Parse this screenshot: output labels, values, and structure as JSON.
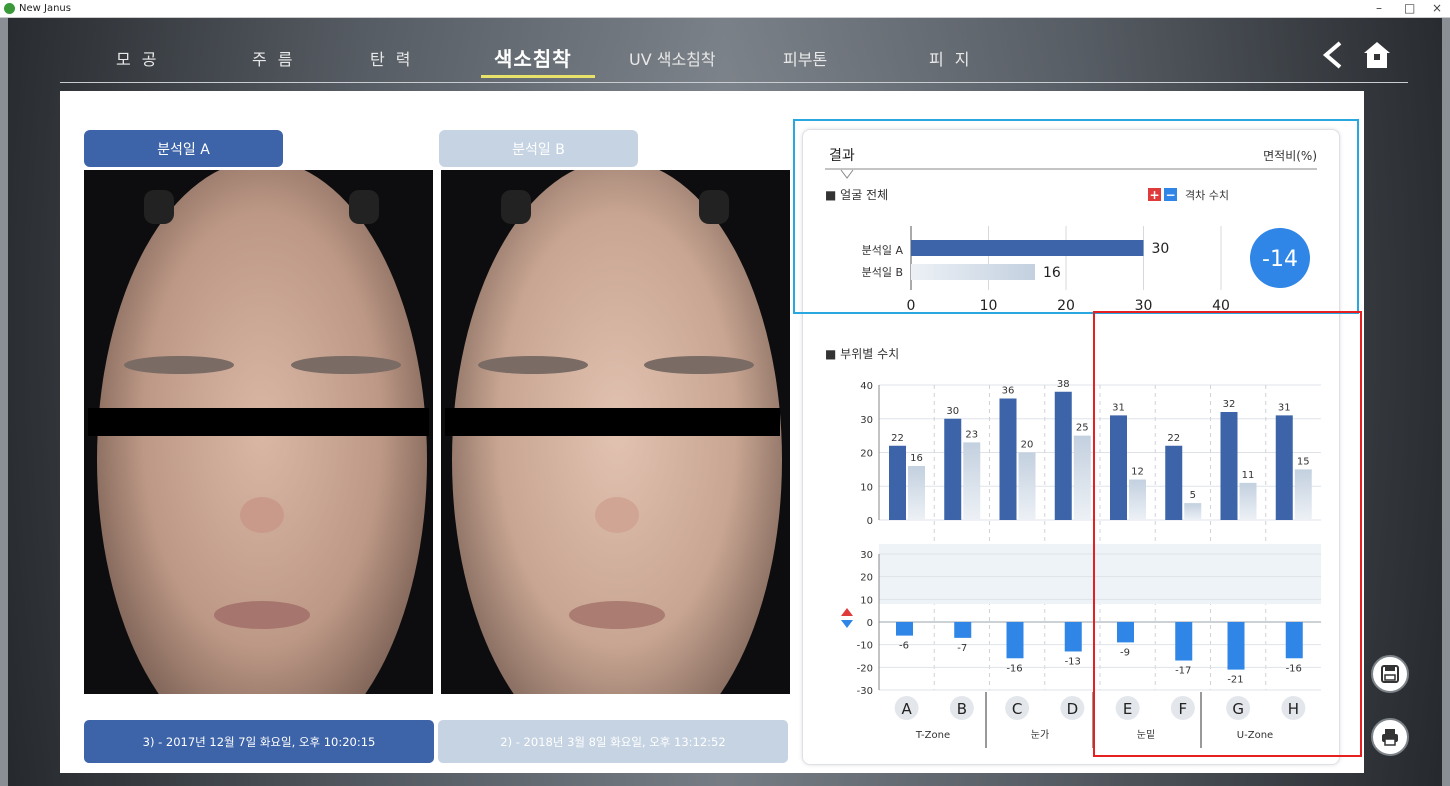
{
  "window": {
    "title": "New Janus",
    "minimize": "–",
    "restore": "□",
    "close": "×"
  },
  "nav": {
    "tabs": [
      {
        "label": "모 공"
      },
      {
        "label": "주 름"
      },
      {
        "label": "탄 력"
      },
      {
        "label": "색소침착"
      },
      {
        "label": "UV 색소침착"
      },
      {
        "label": "피부톤"
      },
      {
        "label": "피 지"
      }
    ],
    "active_index": 3
  },
  "left": {
    "date_a_label": "분석일 A",
    "date_b_label": "분석일 B",
    "date_a_text": "3) - 2017년 12월 7일 화요일, 오후 10:20:15",
    "date_b_text": "2) - 2018년 3월  8일 화요일, 오후 13:12:52"
  },
  "result": {
    "title": "결과",
    "unit": "면적비(%)",
    "whole_face_label": "■ 얼굴 전체",
    "diff_legend": "격차 수치",
    "row_a_label": "분석일 A",
    "row_b_label": "분석일 B",
    "diff_value": "-14",
    "by_region_label": "■ 부위별 수치",
    "zones": [
      "T-Zone",
      "눈가",
      "눈밑",
      "U-Zone"
    ]
  },
  "colors": {
    "blue": "#3d63a8",
    "light": "#c6d3e2",
    "neg": "#2f86e6",
    "accent": "#e8e16a"
  },
  "chart_data": [
    {
      "type": "bar",
      "orientation": "horizontal",
      "categories": [
        "분석일 A",
        "분석일 B"
      ],
      "values": [
        30,
        16
      ],
      "xlim": [
        0,
        40
      ],
      "xticks": [
        0,
        10,
        20,
        30,
        40
      ],
      "grid": true
    },
    {
      "type": "bar",
      "categories": [
        "A",
        "B",
        "C",
        "D",
        "E",
        "F",
        "G",
        "H"
      ],
      "series": [
        {
          "values": [
            22,
            30,
            36,
            38,
            31,
            22,
            32,
            31
          ]
        },
        {
          "values": [
            16,
            23,
            20,
            25,
            12,
            5,
            11,
            15
          ]
        }
      ],
      "ylim": [
        0,
        40
      ],
      "yticks": [
        0,
        10,
        20,
        30,
        40
      ],
      "grid": true
    },
    {
      "type": "bar",
      "categories": [
        "A",
        "B",
        "C",
        "D",
        "E",
        "F",
        "G",
        "H"
      ],
      "values": [
        -6,
        -7,
        -16,
        -13,
        -9,
        -17,
        -21,
        -16
      ],
      "ylim": [
        -30,
        30
      ],
      "yticks": [
        30,
        20,
        10,
        0,
        -10,
        -20,
        -30
      ],
      "grid": true
    }
  ]
}
